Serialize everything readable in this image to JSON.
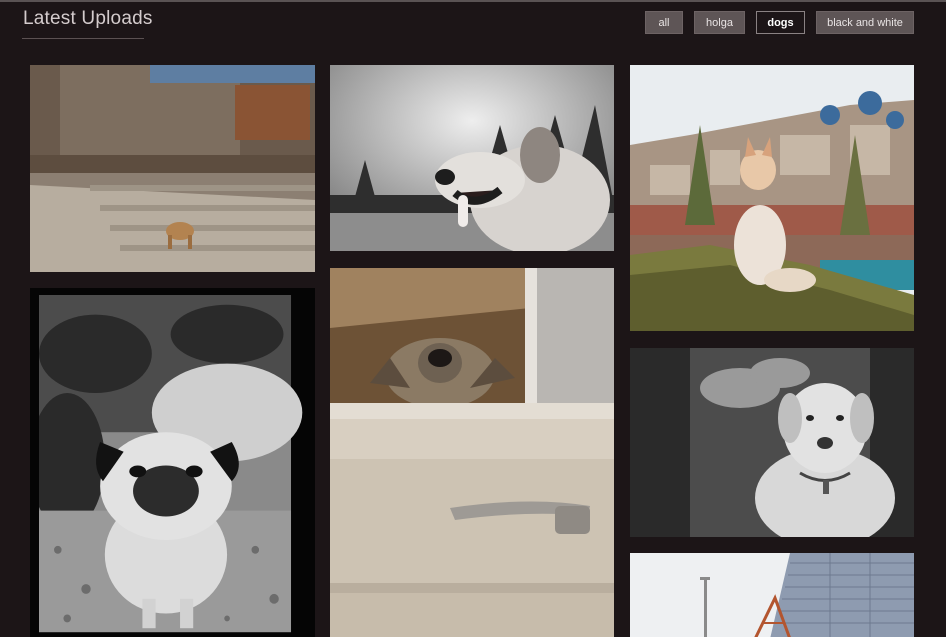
{
  "header": {
    "title": "Latest Uploads"
  },
  "filters": [
    {
      "label": "all",
      "active": false
    },
    {
      "label": "holga",
      "active": false
    },
    {
      "label": "dogs",
      "active": true
    },
    {
      "label": "black and white",
      "active": false
    }
  ],
  "colors": {
    "background": "#1c1517",
    "button_bg": "#5e5556",
    "title_text": "#d4cccd"
  },
  "photos": [
    {
      "subject": "dog-on-stone-stairs",
      "tone": "color"
    },
    {
      "subject": "dog-in-field-sky",
      "tone": "black-and-white"
    },
    {
      "subject": "husky-on-hill-town",
      "tone": "color"
    },
    {
      "subject": "pug-on-gravel",
      "tone": "black-and-white"
    },
    {
      "subject": "dog-in-car-window",
      "tone": "color"
    },
    {
      "subject": "labrador-portrait",
      "tone": "black-and-white"
    },
    {
      "subject": "building-and-crane",
      "tone": "color"
    }
  ]
}
